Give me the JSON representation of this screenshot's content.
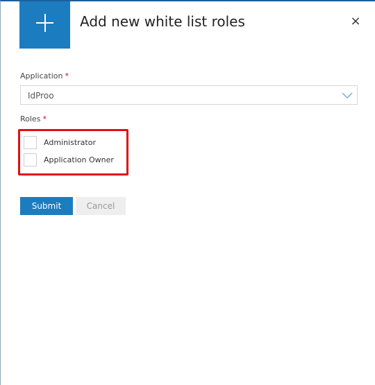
{
  "dialog": {
    "title": "Add new white list roles",
    "close_label": "×"
  },
  "form": {
    "application": {
      "label": "Application",
      "required_marker": "*",
      "selected_value": "IdProo"
    },
    "roles": {
      "label": "Roles",
      "required_marker": "*",
      "options": [
        {
          "label": "Administrator",
          "checked": false
        },
        {
          "label": "Application Owner",
          "checked": false
        }
      ]
    }
  },
  "actions": {
    "submit_label": "Submit",
    "cancel_label": "Cancel"
  },
  "colors": {
    "accent": "#1c7cc0",
    "highlight_border": "#e01010",
    "required": "#d0021b"
  },
  "icons": {
    "header": "plus-icon",
    "close": "close-icon",
    "select": "chevron-down-icon"
  }
}
